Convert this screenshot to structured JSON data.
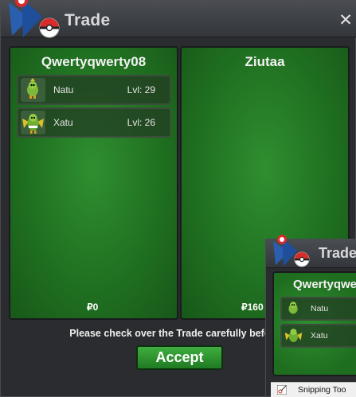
{
  "window": {
    "title": "Trade",
    "close_glyph": "✕"
  },
  "panels": {
    "left": {
      "player": "Qwertyqwerty08",
      "money": "₽0",
      "items": [
        {
          "name": "Natu",
          "level": "Lvl: 29",
          "icon": "natu-icon"
        },
        {
          "name": "Xatu",
          "level": "Lvl: 26",
          "icon": "xatu-icon"
        }
      ]
    },
    "right": {
      "player": "Ziutaa",
      "money": "₽160"
    }
  },
  "notice": "Please check over the Trade carefully before a",
  "accept_label": "Accept",
  "second_window": {
    "title": "Trade",
    "player": "Qwertyqwe",
    "items": [
      {
        "name": "Natu",
        "icon": "natu-icon"
      },
      {
        "name": "Xatu",
        "icon": "xatu-icon"
      }
    ]
  },
  "taskbar": {
    "label": "Snipping Too"
  },
  "colors": {
    "panel_green": "#1f6e20",
    "accept_green": "#2f9a31",
    "titlebar": "#3f4246"
  }
}
